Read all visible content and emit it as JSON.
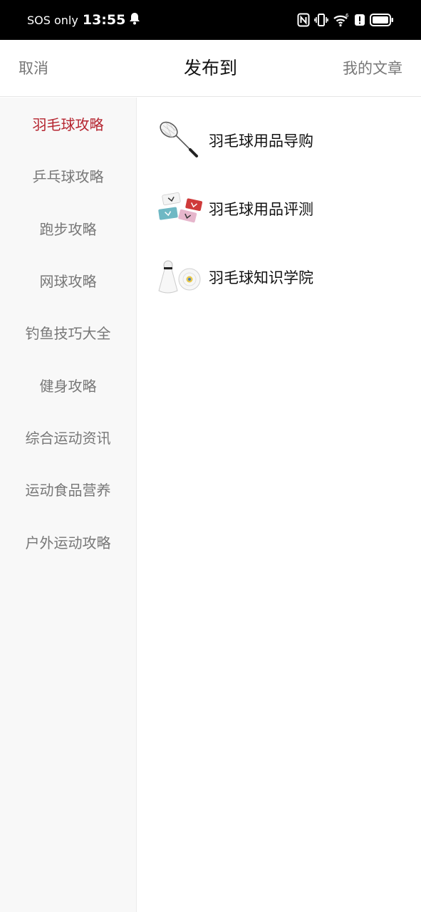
{
  "status_bar": {
    "carrier": "SOS only",
    "time": "13:55",
    "icons": [
      "bell-icon",
      "nfc-icon",
      "vibrate-icon",
      "wifi-icon",
      "alert-icon",
      "battery-icon"
    ]
  },
  "header": {
    "cancel_label": "取消",
    "title": "发布到",
    "my_articles_label": "我的文章"
  },
  "sidebar": {
    "active_index": 0,
    "items": [
      {
        "label": "羽毛球攻略"
      },
      {
        "label": "乒乓球攻略"
      },
      {
        "label": "跑步攻略"
      },
      {
        "label": "网球攻略"
      },
      {
        "label": "钓鱼技巧大全"
      },
      {
        "label": "健身攻略"
      },
      {
        "label": "综合运动资讯"
      },
      {
        "label": "运动食品营养"
      },
      {
        "label": "户外运动攻略"
      }
    ]
  },
  "content": {
    "items": [
      {
        "label": "羽毛球用品导购",
        "icon": "badminton-racket-icon"
      },
      {
        "label": "羽毛球用品评测",
        "icon": "wristbands-icon"
      },
      {
        "label": "羽毛球知识学院",
        "icon": "shuttlecock-icon"
      }
    ]
  },
  "colors": {
    "accent": "#b5242f",
    "sidebar_bg": "#f8f8f8",
    "muted_text": "#777777"
  }
}
